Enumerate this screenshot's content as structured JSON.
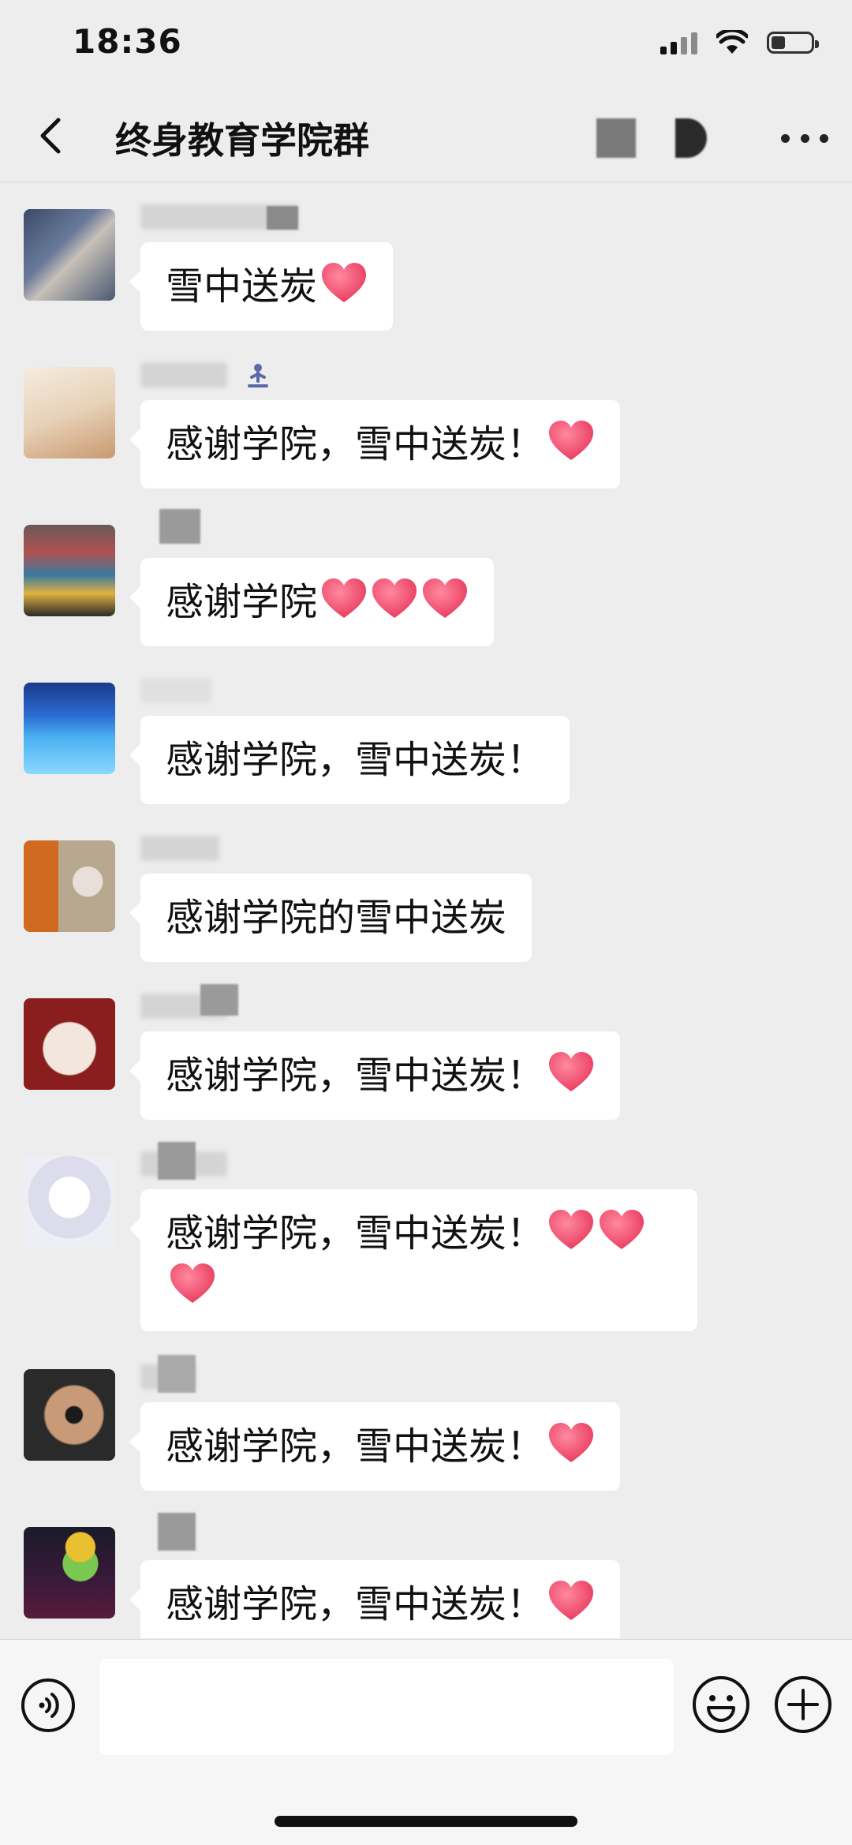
{
  "status_bar": {
    "time": "18:36"
  },
  "nav": {
    "title": "终身教育学院群"
  },
  "messages": [
    {
      "text": "雪中送炭",
      "hearts": 1
    },
    {
      "text": "感谢学院，雪中送炭！",
      "hearts": 1
    },
    {
      "text": "感谢学院",
      "hearts": 3
    },
    {
      "text": "感谢学院，雪中送炭！",
      "hearts": 0
    },
    {
      "text": "感谢学院的雪中送炭",
      "hearts": 0
    },
    {
      "text": "感谢学院，雪中送炭！",
      "hearts": 1
    },
    {
      "text": "感谢学院，雪中送炭！",
      "hearts": 3
    },
    {
      "text": "感谢学院，雪中送炭！",
      "hearts": 1
    },
    {
      "text": "感谢学院，雪中送炭！",
      "hearts": 1
    }
  ],
  "icons": {
    "back": "chevron-left-icon",
    "more": "more-dots-icon",
    "voice": "voice-icon",
    "emoji": "emoji-icon",
    "plus": "plus-icon",
    "heart": "heart-emoji-icon"
  },
  "colors": {
    "background": "#ededed",
    "bubble": "#ffffff",
    "heart": "#f04a6a"
  }
}
